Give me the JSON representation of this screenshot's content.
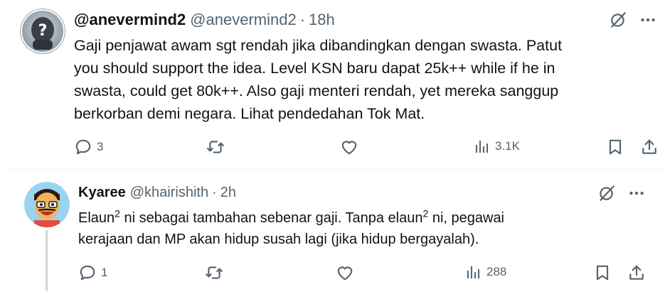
{
  "tweets": [
    {
      "display_name": "@anevermind2",
      "handle": "@anevermind2",
      "separator": "·",
      "time": "18h",
      "lines": [
        "Gaji penjawat awam sgt rendah jika dibandingkan dengan swasta. Patut",
        "you should support the idea. Level KSN baru dapat 25k++ while if he in",
        "swasta, could get 80k++. Also gaji menteri rendah, yet mereka sanggup",
        "berkorban demi negara. Lihat pendedahan Tok Mat."
      ],
      "replies": "3",
      "views": "3.1K"
    },
    {
      "display_name": "Kyaree",
      "handle": "@khairishith",
      "separator": "·",
      "time": "2h",
      "line1_a": "Elaun",
      "line1_sup1": "2",
      "line1_b": " ni sebagai tambahan sebenar gaji.  Tanpa elaun",
      "line1_sup2": "2",
      "line1_c": " ni, pegawai",
      "line2": "kerajaan dan MP akan hidup susah lagi (jika hidup bergayalah).",
      "replies": "1",
      "views": "288"
    }
  ],
  "icons": [
    "grok-icon",
    "more-icon",
    "reply-icon",
    "retweet-icon",
    "like-icon",
    "views-icon",
    "bookmark-icon",
    "share-icon"
  ],
  "colors": {
    "text": "#0f1419",
    "secondary": "#536471",
    "border": "#eff3f4",
    "thread": "#cfd9de"
  }
}
